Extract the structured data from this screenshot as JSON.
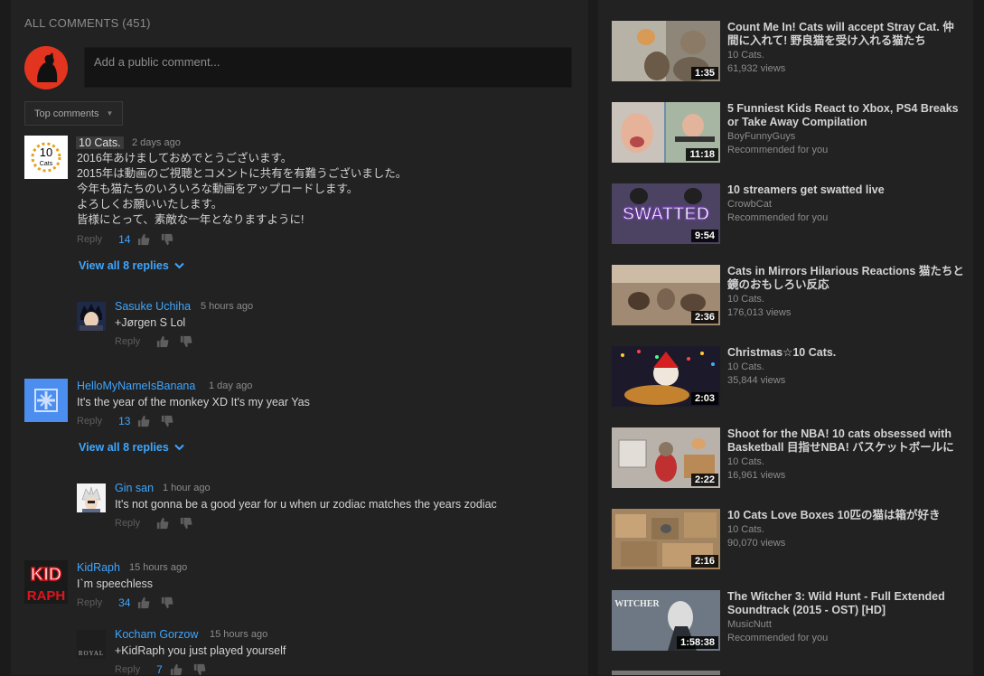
{
  "comments_header": "ALL COMMENTS (451)",
  "comment_box": {
    "placeholder": "Add a public comment..."
  },
  "sort": {
    "label": "Top comments"
  },
  "actions": {
    "reply": "Reply"
  },
  "comments": [
    {
      "author": "10 Cats.",
      "time": "2 days ago",
      "text": "2016年あけましておめでとうございます。\n2015年は動画のご視聴とコメントに共有を有難うございました。\n今年も猫たちのいろいろな動画をアップロードします。\nよろしくお願いいたします。\n皆様にとって、素敵な一年となりますように!",
      "likes": "14",
      "view_replies": "View all 8 replies",
      "avatar_text": "10",
      "avatar_sub": "Cats",
      "reply": {
        "author": "Sasuke Uchiha",
        "time": "5 hours ago",
        "text": "+Jørgen S Lol"
      }
    },
    {
      "author": "HelloMyNameIsBanana",
      "time": "1 day ago",
      "text": "It's the year of the monkey XD It's my year Yas",
      "likes": "13",
      "view_replies": "View all 8 replies",
      "reply": {
        "author": "Gin san",
        "time": "1 hour ago",
        "text": "It's not gonna be a good year for u when ur zodiac matches the years zodiac"
      }
    },
    {
      "author": "KidRaph",
      "time": "15 hours ago",
      "text": "I`m speechless",
      "likes": "34",
      "avatar_text_1": "KID",
      "avatar_text_2": "RAPH",
      "reply": {
        "author": "Kocham Gorzow",
        "time": "15 hours ago",
        "text": "+KidRaph you just played yourself",
        "likes": "7",
        "avatar_text": "ROYAL"
      }
    }
  ],
  "videos": [
    {
      "title": "Count Me In! Cats will accept Stray Cat. 仲間に入れて! 野良猫を受け入れる猫たち",
      "channel": "10 Cats.",
      "meta": "61,932 views",
      "duration": "1:35"
    },
    {
      "title": "5 Funniest Kids React to Xbox, PS4 Breaks or Take Away Compilation",
      "channel": "BoyFunnyGuys",
      "meta": "Recommended for you",
      "duration": "11:18"
    },
    {
      "title": "10 streamers get swatted live",
      "channel": "CrowbCat",
      "meta": "Recommended for you",
      "duration": "9:54",
      "thumb_text": "SWATTED"
    },
    {
      "title": "Cats in Mirrors Hilarious Reactions 猫たちと鏡のおもしろい反応",
      "channel": "10 Cats.",
      "meta": "176,013 views",
      "duration": "2:36"
    },
    {
      "title": "Christmas☆10 Cats.",
      "channel": "10 Cats.",
      "meta": "35,844 views",
      "duration": "2:03"
    },
    {
      "title": "Shoot for the NBA! 10 cats obsessed with Basketball 目指せNBA! バスケットボールに",
      "channel": "10 Cats.",
      "meta": "16,961 views",
      "duration": "2:22"
    },
    {
      "title": "10 Cats Love Boxes 10匹の猫は箱が好き",
      "channel": "10 Cats.",
      "meta": "90,070 views",
      "duration": "2:16"
    },
    {
      "title": "The Witcher 3: Wild Hunt - Full Extended Soundtrack (2015 - OST) [HD]",
      "channel": "MusicNutt",
      "meta": "Recommended for you",
      "duration": "1:58:38",
      "thumb_text": "WITCHER"
    }
  ]
}
